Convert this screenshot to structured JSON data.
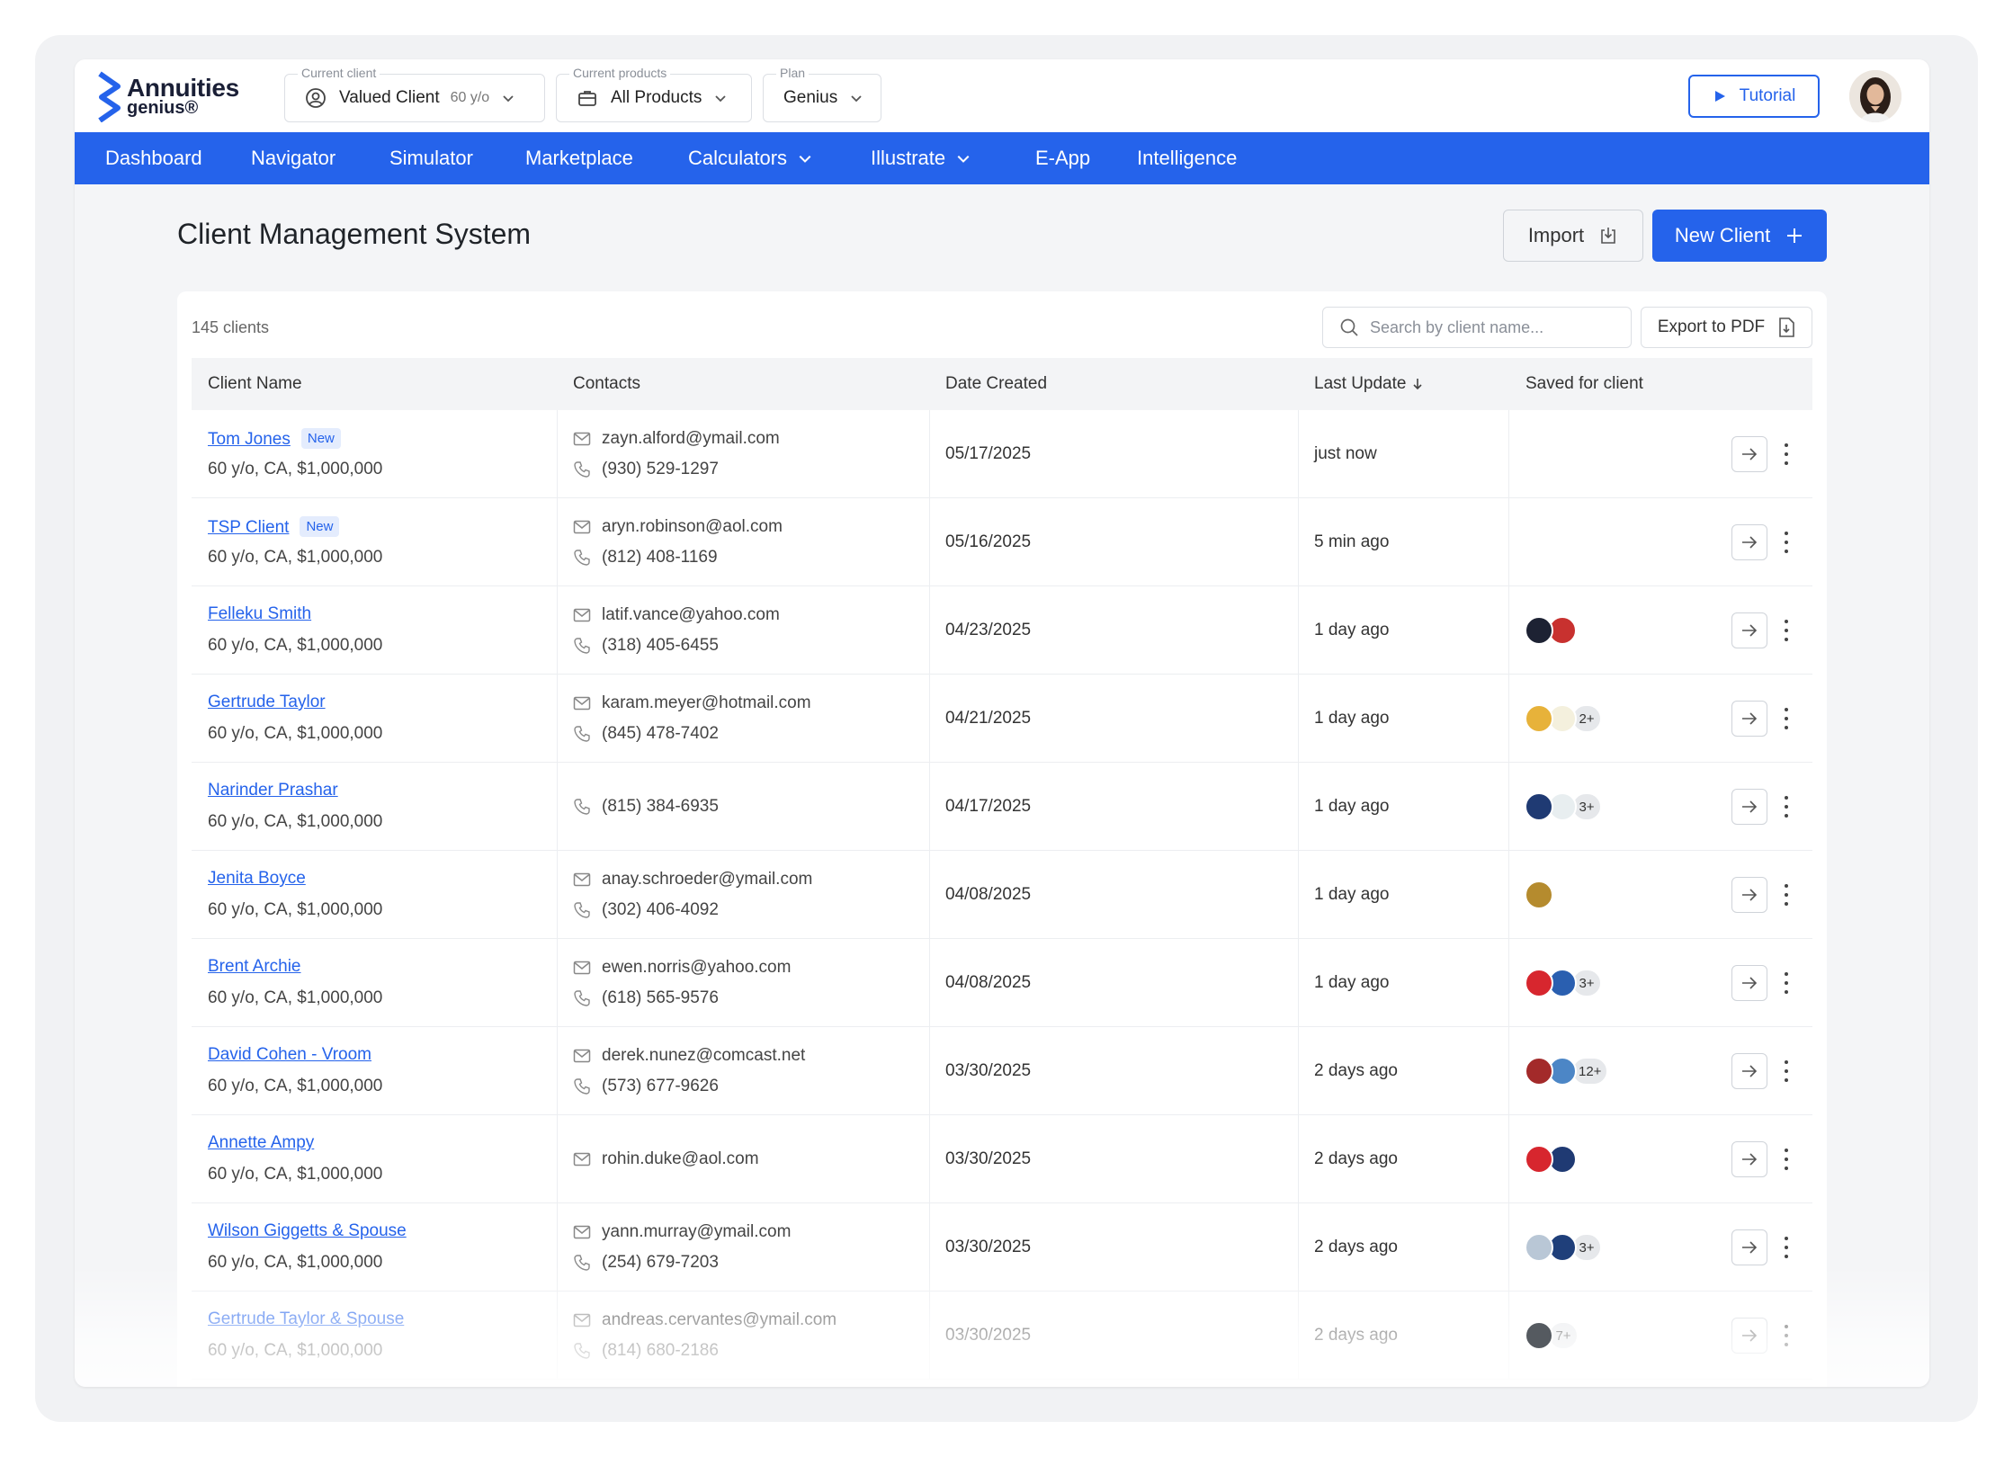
{
  "brand": {
    "line1": "Annuities",
    "line2": "genius®"
  },
  "selectors": {
    "client": {
      "label": "Current client",
      "value": "Valued Client",
      "sub": "60 y/o"
    },
    "products": {
      "label": "Current products",
      "value": "All Products"
    },
    "plan": {
      "label": "Plan",
      "value": "Genius"
    }
  },
  "tutorial_label": "Tutorial",
  "nav": [
    "Dashboard",
    "Navigator",
    "Simulator",
    "Marketplace",
    "Calculators",
    "Illustrate",
    "E-App",
    "Intelligence"
  ],
  "page": {
    "title": "Client Management System",
    "import_label": "Import",
    "new_client_label": "New Client"
  },
  "table": {
    "count": "145 clients",
    "search_placeholder": "Search by client name...",
    "export_label": "Export to PDF",
    "headers": [
      "Client Name",
      "Contacts",
      "Date Created",
      "Last Update",
      "Saved for client"
    ],
    "rows": [
      {
        "name": "Tom Jones",
        "badge": "New",
        "meta": "60 y/o, CA, $1,000,000",
        "email": "zayn.alford@ymail.com",
        "phone": "(930) 529-1297",
        "date": "05/17/2025",
        "update": "just now",
        "logos": [],
        "more": ""
      },
      {
        "name": "TSP Client",
        "badge": "New",
        "meta": "60 y/o, CA, $1,000,000",
        "email": "aryn.robinson@aol.com",
        "phone": "(812) 408-1169",
        "date": "05/16/2025",
        "update": "5 min ago",
        "logos": [],
        "more": ""
      },
      {
        "name": "Felleku Smith",
        "badge": "",
        "meta": "60 y/o, CA, $1,000,000",
        "email": "latif.vance@yahoo.com",
        "phone": "(318) 405-6455",
        "date": "04/23/2025",
        "update": "1 day ago",
        "logos": [
          "#1d2233",
          "#c8312f"
        ],
        "more": ""
      },
      {
        "name": "Gertrude Taylor",
        "badge": "",
        "meta": "60 y/o, CA, $1,000,000",
        "email": "karam.meyer@hotmail.com",
        "phone": "(845) 478-7402",
        "date": "04/21/2025",
        "update": "1 day ago",
        "logos": [
          "#e7b23a",
          "#f4f0dd"
        ],
        "more": "2+"
      },
      {
        "name": "Narinder Prashar",
        "badge": "",
        "meta": "60 y/o, CA, $1,000,000",
        "email": "",
        "phone": "(815) 384-6935",
        "date": "04/17/2025",
        "update": "1 day ago",
        "logos": [
          "#1f3a73",
          "#e8eef0"
        ],
        "more": "3+"
      },
      {
        "name": "Jenita Boyce",
        "badge": "",
        "meta": "60 y/o, CA, $1,000,000",
        "email": "anay.schroeder@ymail.com",
        "phone": "(302) 406-4092",
        "date": "04/08/2025",
        "update": "1 day ago",
        "logos": [
          "#b58b2e"
        ],
        "more": ""
      },
      {
        "name": "Brent Archie",
        "badge": "",
        "meta": "60 y/o, CA, $1,000,000",
        "email": "ewen.norris@yahoo.com",
        "phone": "(618) 565-9576",
        "date": "04/08/2025",
        "update": "1 day ago",
        "logos": [
          "#d7262e",
          "#2a5fb0"
        ],
        "more": "3+"
      },
      {
        "name": "David Cohen - Vroom",
        "badge": "",
        "meta": "60 y/o, CA, $1,000,000",
        "email": "derek.nunez@comcast.net",
        "phone": "(573) 677-9626",
        "date": "03/30/2025",
        "update": "2 days ago",
        "logos": [
          "#a32a2a",
          "#4c86c6"
        ],
        "more": "12+"
      },
      {
        "name": "Annette Ampy",
        "badge": "",
        "meta": "60 y/o, CA, $1,000,000",
        "email": "rohin.duke@aol.com",
        "phone": "",
        "date": "03/30/2025",
        "update": "2 days ago",
        "logos": [
          "#d7262e",
          "#1f3a73"
        ],
        "more": ""
      },
      {
        "name": "Wilson Giggetts & Spouse",
        "badge": "",
        "meta": "60 y/o, CA, $1,000,000",
        "email": "yann.murray@ymail.com",
        "phone": "(254) 679-7203",
        "date": "03/30/2025",
        "update": "2 days ago",
        "logos": [
          "#b9c7d6",
          "#1f3f7a"
        ],
        "more": "3+"
      },
      {
        "name": "Gertrude Taylor  & Spouse",
        "badge": "",
        "meta": "60 y/o, CA, $1,000,000",
        "email": "andreas.cervantes@ymail.com",
        "phone": "(814) 680-2186",
        "date": "03/30/2025",
        "update": "2 days ago",
        "logos": [
          "#555a60"
        ],
        "more": "7+"
      }
    ]
  },
  "colors": {
    "accent": "#2563eb",
    "nav_bg": "#2563eb",
    "badge_bg": "#e4ecfd"
  }
}
